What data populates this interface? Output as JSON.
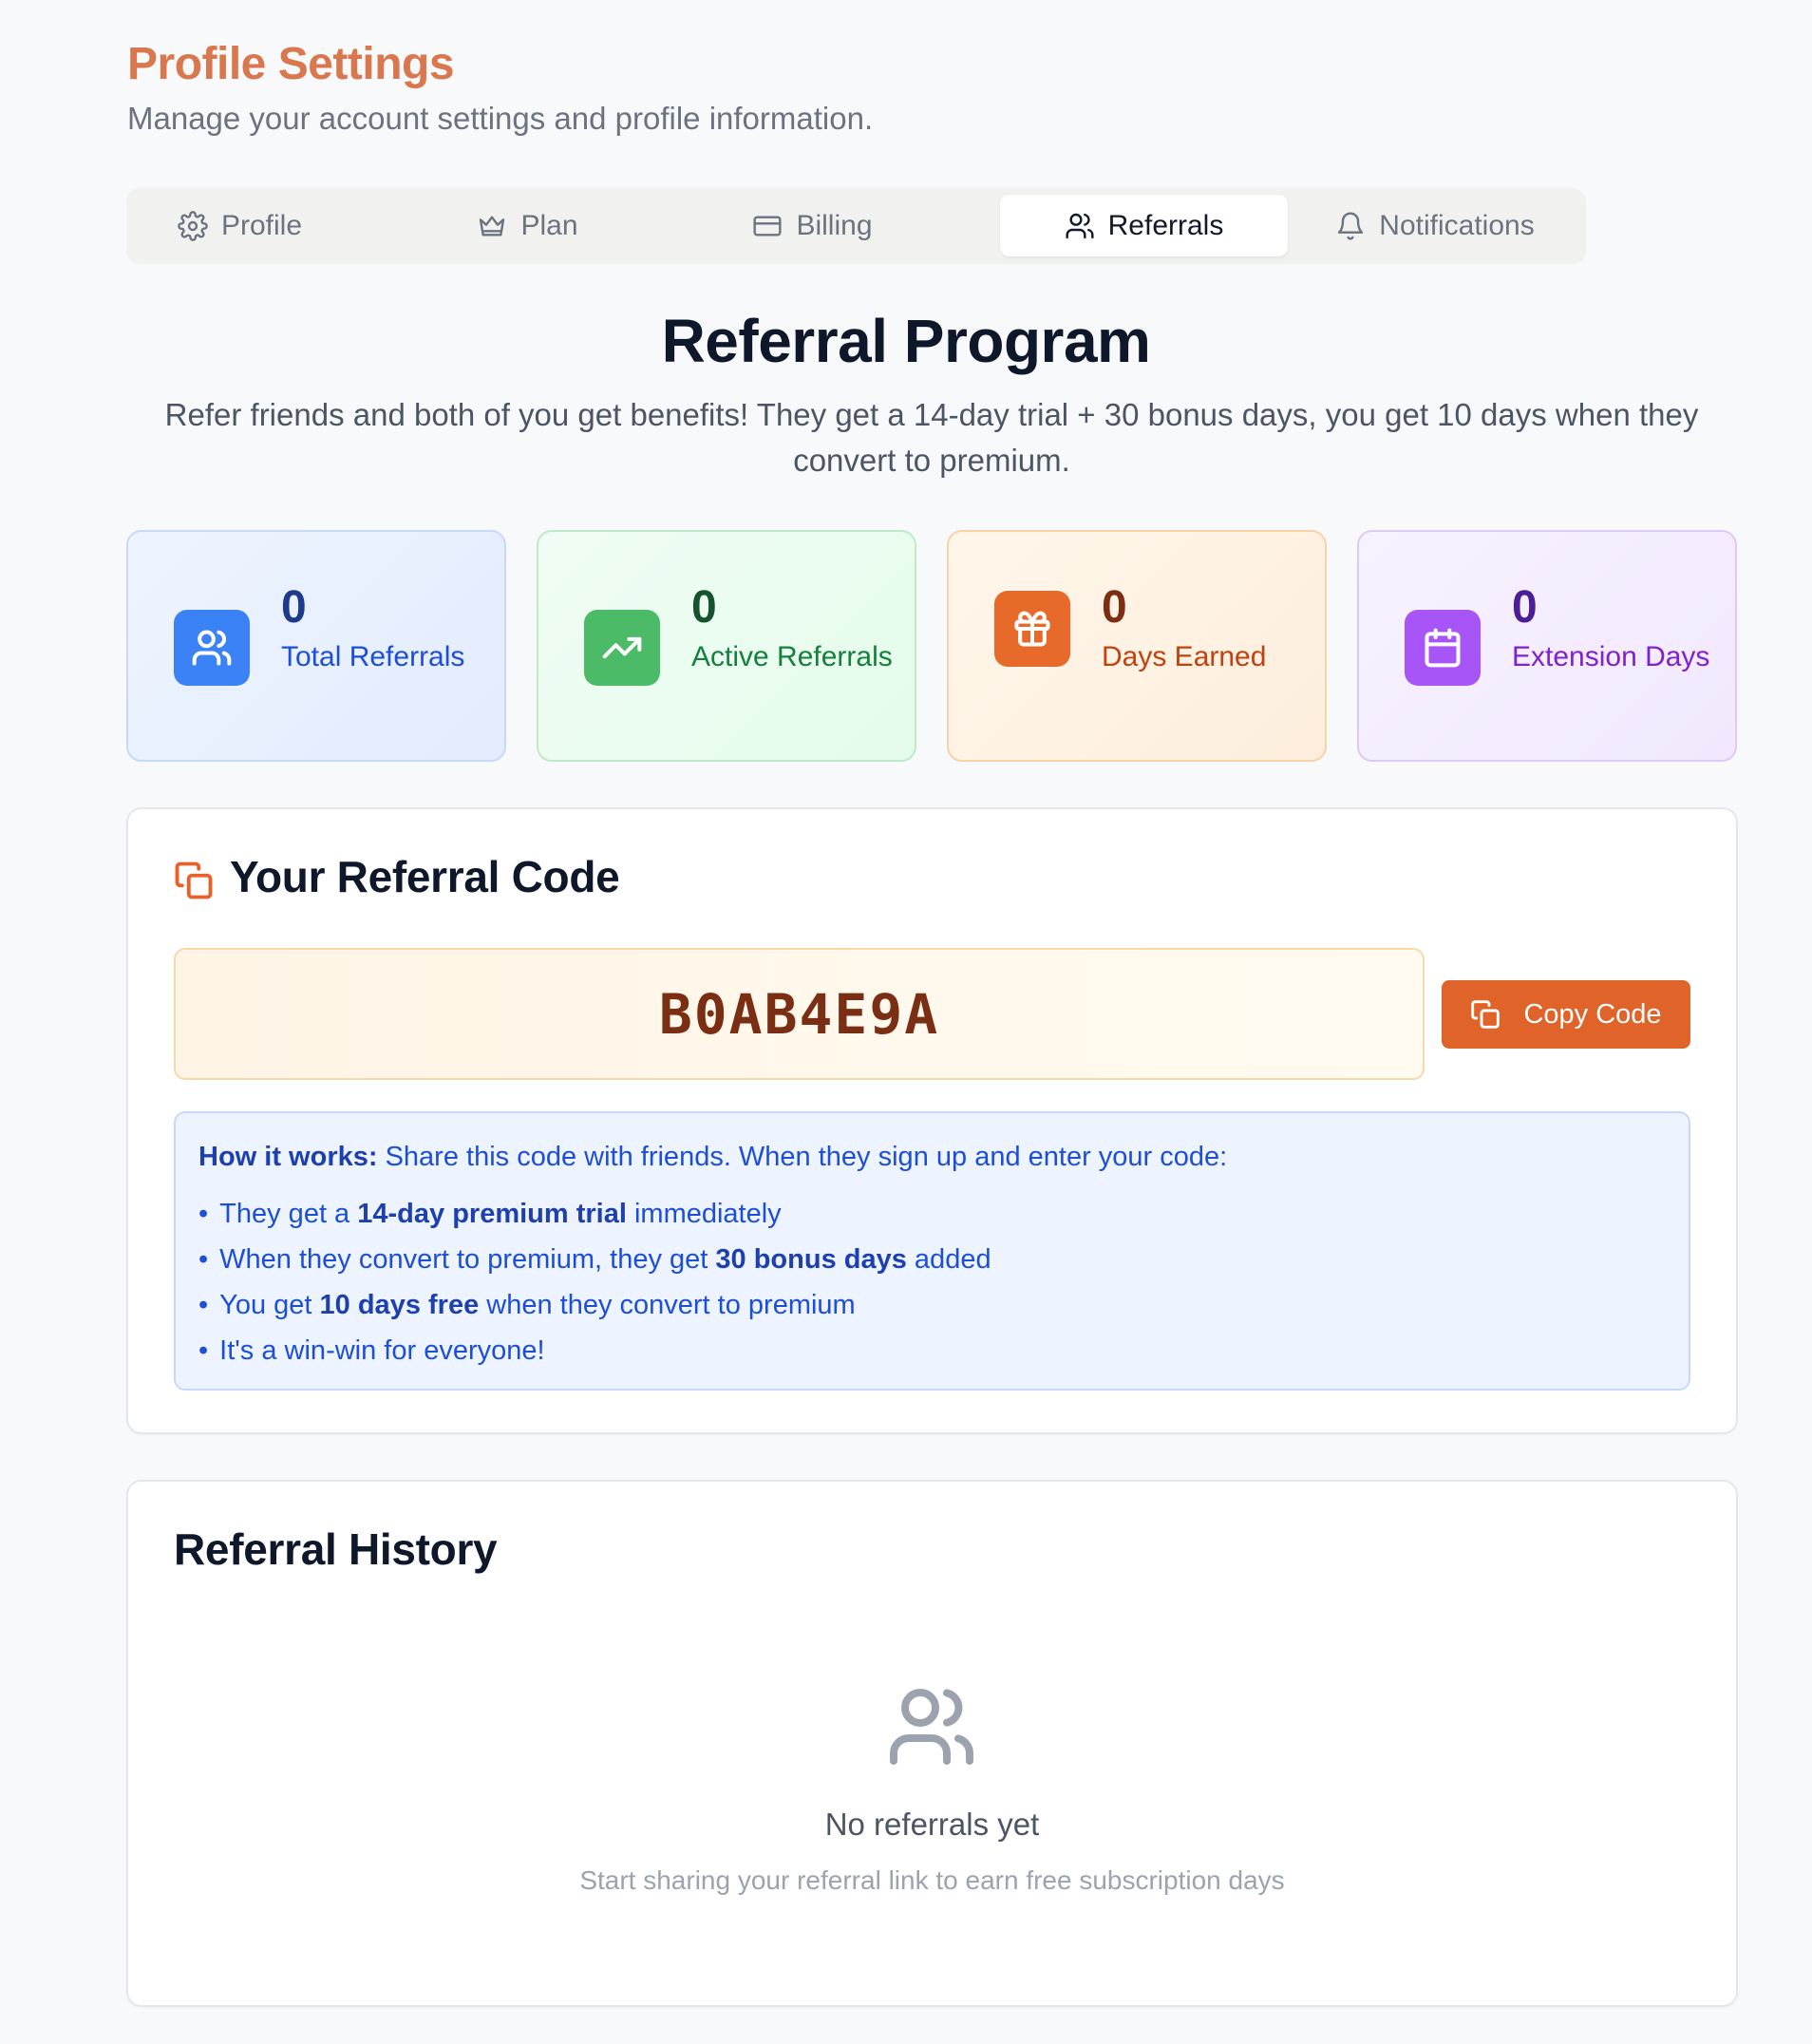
{
  "header": {
    "title": "Profile Settings",
    "subtitle": "Manage your account settings and profile information."
  },
  "tabs": [
    {
      "label": "Profile",
      "icon": "gear-icon",
      "active": false
    },
    {
      "label": "Plan",
      "icon": "crown-icon",
      "active": false
    },
    {
      "label": "Billing",
      "icon": "credit-card-icon",
      "active": false
    },
    {
      "label": "Referrals",
      "icon": "users-icon",
      "active": true
    },
    {
      "label": "Notifications",
      "icon": "bell-icon",
      "active": false
    }
  ],
  "program": {
    "title": "Referral Program",
    "description": "Refer friends and both of you get benefits! They get a 14-day trial + 30 bonus days, you get 10 days when they convert to premium."
  },
  "stats": [
    {
      "value": "0",
      "label": "Total Referrals",
      "icon": "users-icon",
      "color": "#3b82f6"
    },
    {
      "value": "0",
      "label": "Active Referrals",
      "icon": "trending-up-icon",
      "color": "#4cbb68"
    },
    {
      "value": "0",
      "label": "Days Earned",
      "icon": "gift-icon",
      "color": "#e86a2b"
    },
    {
      "value": "0",
      "label": "Extension Days",
      "icon": "calendar-icon",
      "color": "#a855f7"
    }
  ],
  "referral_code": {
    "title": "Your Referral Code",
    "code": "B0AB4E9A",
    "copy_label": "Copy Code",
    "how_it_works": {
      "lead": "How it works:",
      "intro": "Share this code with friends. When they sign up and enter your code:",
      "items": [
        {
          "pre": "They get a ",
          "bold": "14-day premium trial",
          "post": " immediately"
        },
        {
          "pre": "When they convert to premium, they get ",
          "bold": "30 bonus days",
          "post": " added"
        },
        {
          "pre": "You get ",
          "bold": "10 days free",
          "post": " when they convert to premium"
        },
        {
          "pre": "It's a win-win for everyone!",
          "bold": "",
          "post": ""
        }
      ]
    }
  },
  "history": {
    "title": "Referral History",
    "empty_title": "No referrals yet",
    "empty_desc": "Start sharing your referral link to earn free subscription days"
  },
  "colors": {
    "accent": "#e0632a",
    "title": "#d9784f"
  }
}
